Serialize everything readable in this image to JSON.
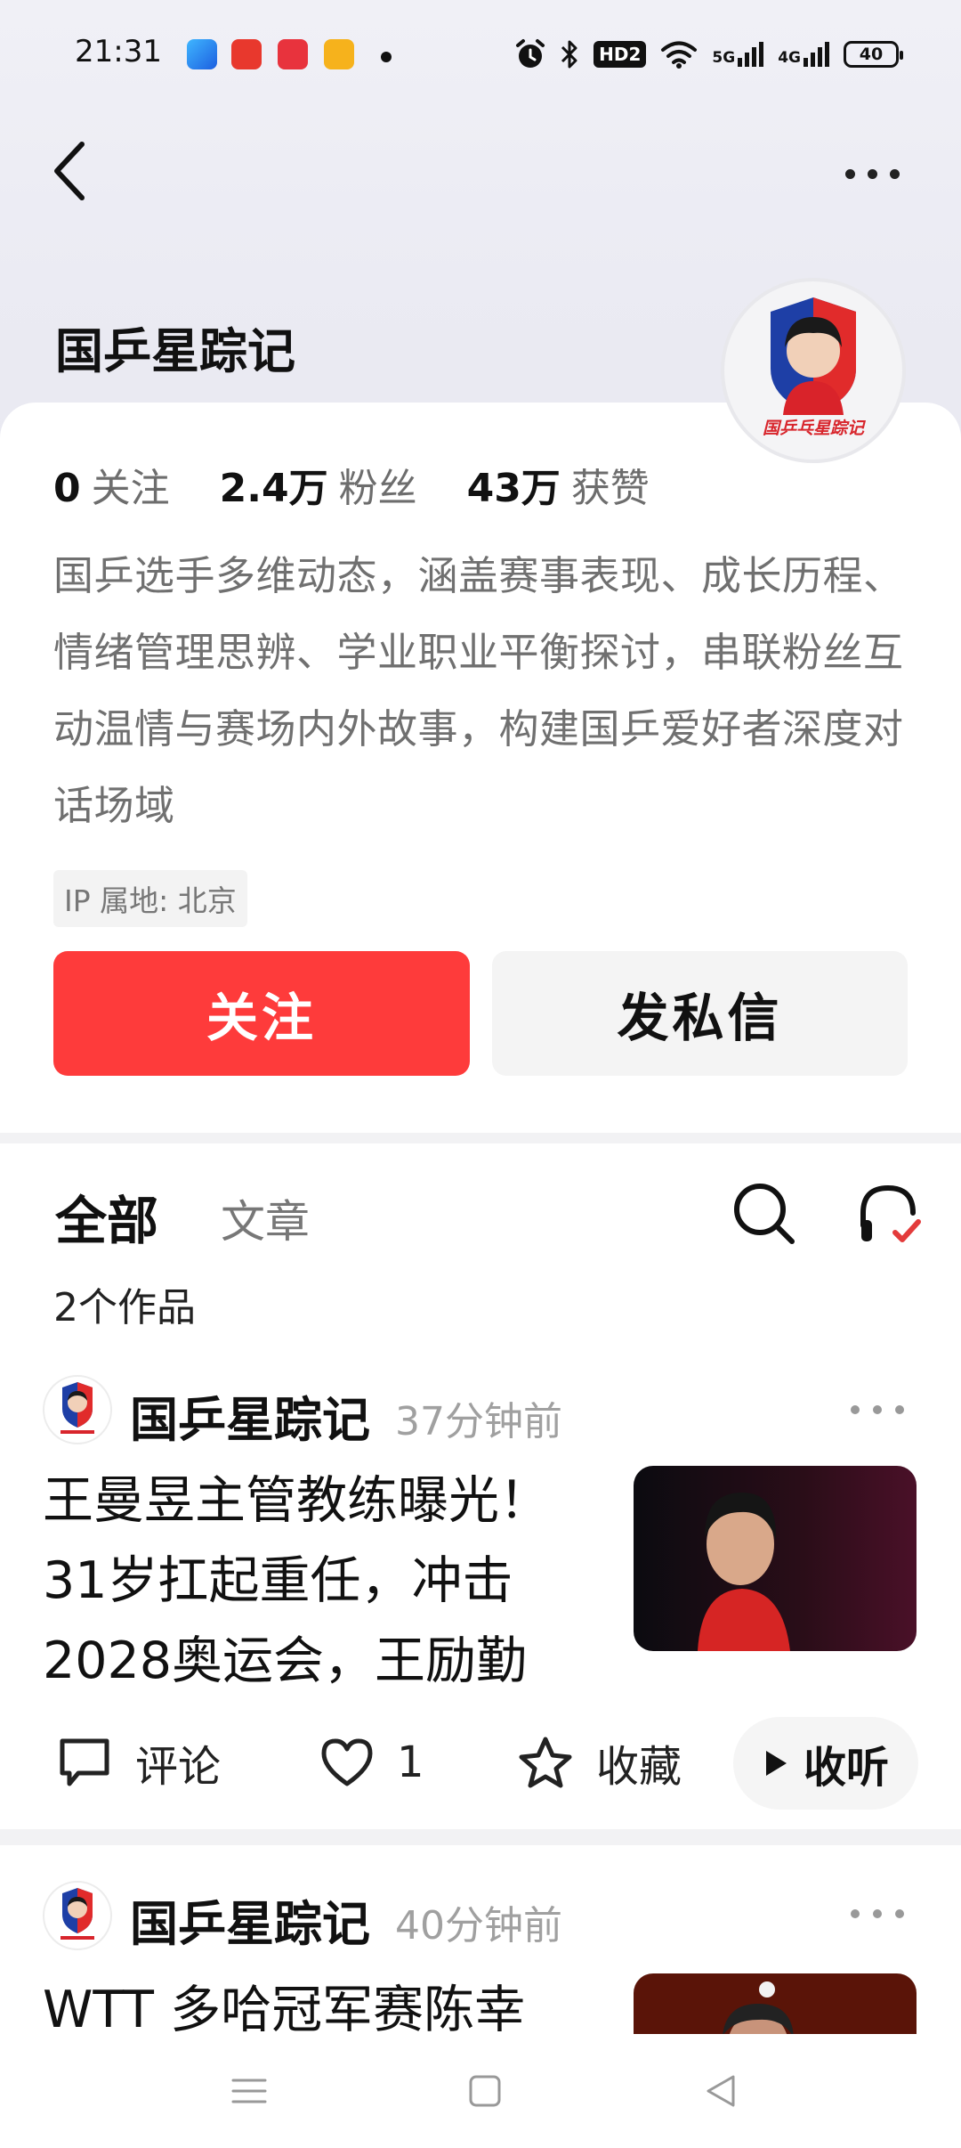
{
  "status_bar": {
    "time": "21:31",
    "hd_label": "HD2",
    "network_5g": "5G",
    "network_4g": "4G",
    "battery": "40"
  },
  "profile": {
    "name": "国乒星踪记",
    "avatar_text": "国乒乓星踪记",
    "stats": [
      {
        "value": "0",
        "label": "关注"
      },
      {
        "value": "2.4万",
        "label": "粉丝"
      },
      {
        "value": "43万",
        "label": "获赞"
      }
    ],
    "bio": "国乒选手多维动态，涵盖赛事表现、成长历程、情绪管理思辨、学业职业平衡探讨，串联粉丝互动温情与赛场内外故事，构建国乒爱好者深度对话场域",
    "ip_location": "IP 属地: 北京",
    "follow_label": "关注",
    "message_label": "发私信"
  },
  "tabs": {
    "all": "全部",
    "article": "文章"
  },
  "works_count": "2个作品",
  "posts": [
    {
      "author": "国乒星踪记",
      "time": "37分钟前",
      "title": "王曼昱主管教练曝光！31岁扛起重任，冲击2028奥运会，王励勤",
      "comment_label": "评论",
      "like_count": "1",
      "favorite_label": "收藏",
      "listen_label": "收听"
    },
    {
      "author": "国乒星踪记",
      "time": "40分钟前",
      "title": "WTT 多哈冠军赛陈幸"
    }
  ],
  "colors": {
    "accent": "#fe3b3b",
    "background": "#f2f2f4"
  }
}
